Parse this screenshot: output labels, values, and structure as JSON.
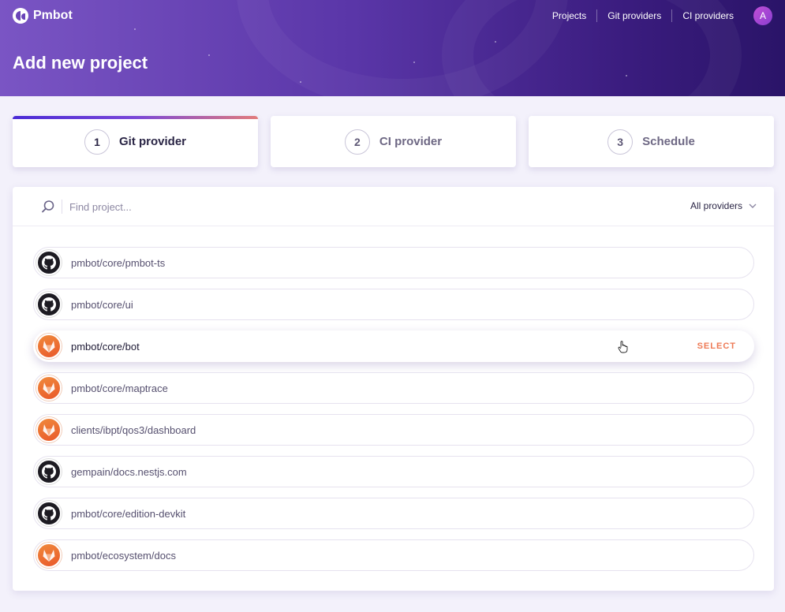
{
  "app": {
    "name": "Pmbot"
  },
  "nav": {
    "items": [
      "Projects",
      "Git providers",
      "CI providers"
    ],
    "avatar_initial": "A"
  },
  "page": {
    "title": "Add new project"
  },
  "steps": [
    {
      "number": "1",
      "label": "Git provider",
      "active": true
    },
    {
      "number": "2",
      "label": "CI provider",
      "active": false
    },
    {
      "number": "3",
      "label": "Schedule",
      "active": false
    }
  ],
  "search": {
    "placeholder": "Find project...",
    "value": ""
  },
  "filter": {
    "label": "All providers"
  },
  "repos": [
    {
      "name": "pmbot/core/pmbot-ts",
      "provider": "github"
    },
    {
      "name": "pmbot/core/ui",
      "provider": "github"
    },
    {
      "name": "pmbot/core/bot",
      "provider": "gitlab",
      "hovered": true,
      "action": "SELECT"
    },
    {
      "name": "pmbot/core/maptrace",
      "provider": "gitlab"
    },
    {
      "name": "clients/ibpt/qos3/dashboard",
      "provider": "gitlab"
    },
    {
      "name": "gempain/docs.nestjs.com",
      "provider": "github"
    },
    {
      "name": "pmbot/core/edition-devkit",
      "provider": "github"
    },
    {
      "name": "pmbot/ecosystem/docs",
      "provider": "gitlab"
    }
  ],
  "colors": {
    "accent": "#ee7a55",
    "brand": "#5a36a8"
  }
}
